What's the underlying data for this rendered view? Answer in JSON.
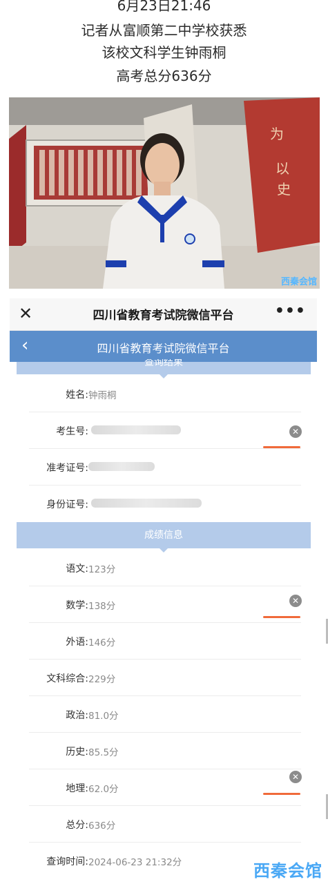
{
  "caption": {
    "line1": "6月23日21:46",
    "line2": "记者从富顺第二中学校获悉",
    "line3": "该校文科学生钟雨桐",
    "line4": "高考总分636分"
  },
  "photo": {
    "watermark": "西秦会馆",
    "wall_text": "为国 以史明志"
  },
  "wechat": {
    "window_title": "四川省教育考试院微信平台",
    "page_title": "四川省教育考试院微信平台",
    "query_section": "查询结果",
    "score_section": "成绩信息",
    "info_rows": [
      {
        "label": "姓名:",
        "value": "钟雨桐"
      },
      {
        "label": "考生号:",
        "value": ""
      },
      {
        "label": "准考证号:",
        "value": ""
      },
      {
        "label": "身份证号:",
        "value": ""
      }
    ],
    "score_rows": [
      {
        "label": "语文:",
        "value": "123分"
      },
      {
        "label": "数学:",
        "value": "138分"
      },
      {
        "label": "外语:",
        "value": "146分"
      },
      {
        "label": "文科综合:",
        "value": "229分"
      },
      {
        "label": "政治:",
        "value": "81.0分"
      },
      {
        "label": "历史:",
        "value": "85.5分"
      },
      {
        "label": "地理:",
        "value": "62.0分"
      },
      {
        "label": "总分:",
        "value": "636分"
      },
      {
        "label": "查询时间:",
        "value": "2024-06-23 21:32分"
      }
    ]
  },
  "footer_watermark": "西秦会馆",
  "colors": {
    "header_blue": "#5b8ecb",
    "section_blue": "#b4cbea",
    "accent_red": "#f06a3a",
    "watermark_blue": "#4aa8f5"
  },
  "icons": {
    "close": "close-icon",
    "more": "more-dots-icon",
    "back": "chevron-left-icon",
    "clear": "circle-x-icon"
  }
}
